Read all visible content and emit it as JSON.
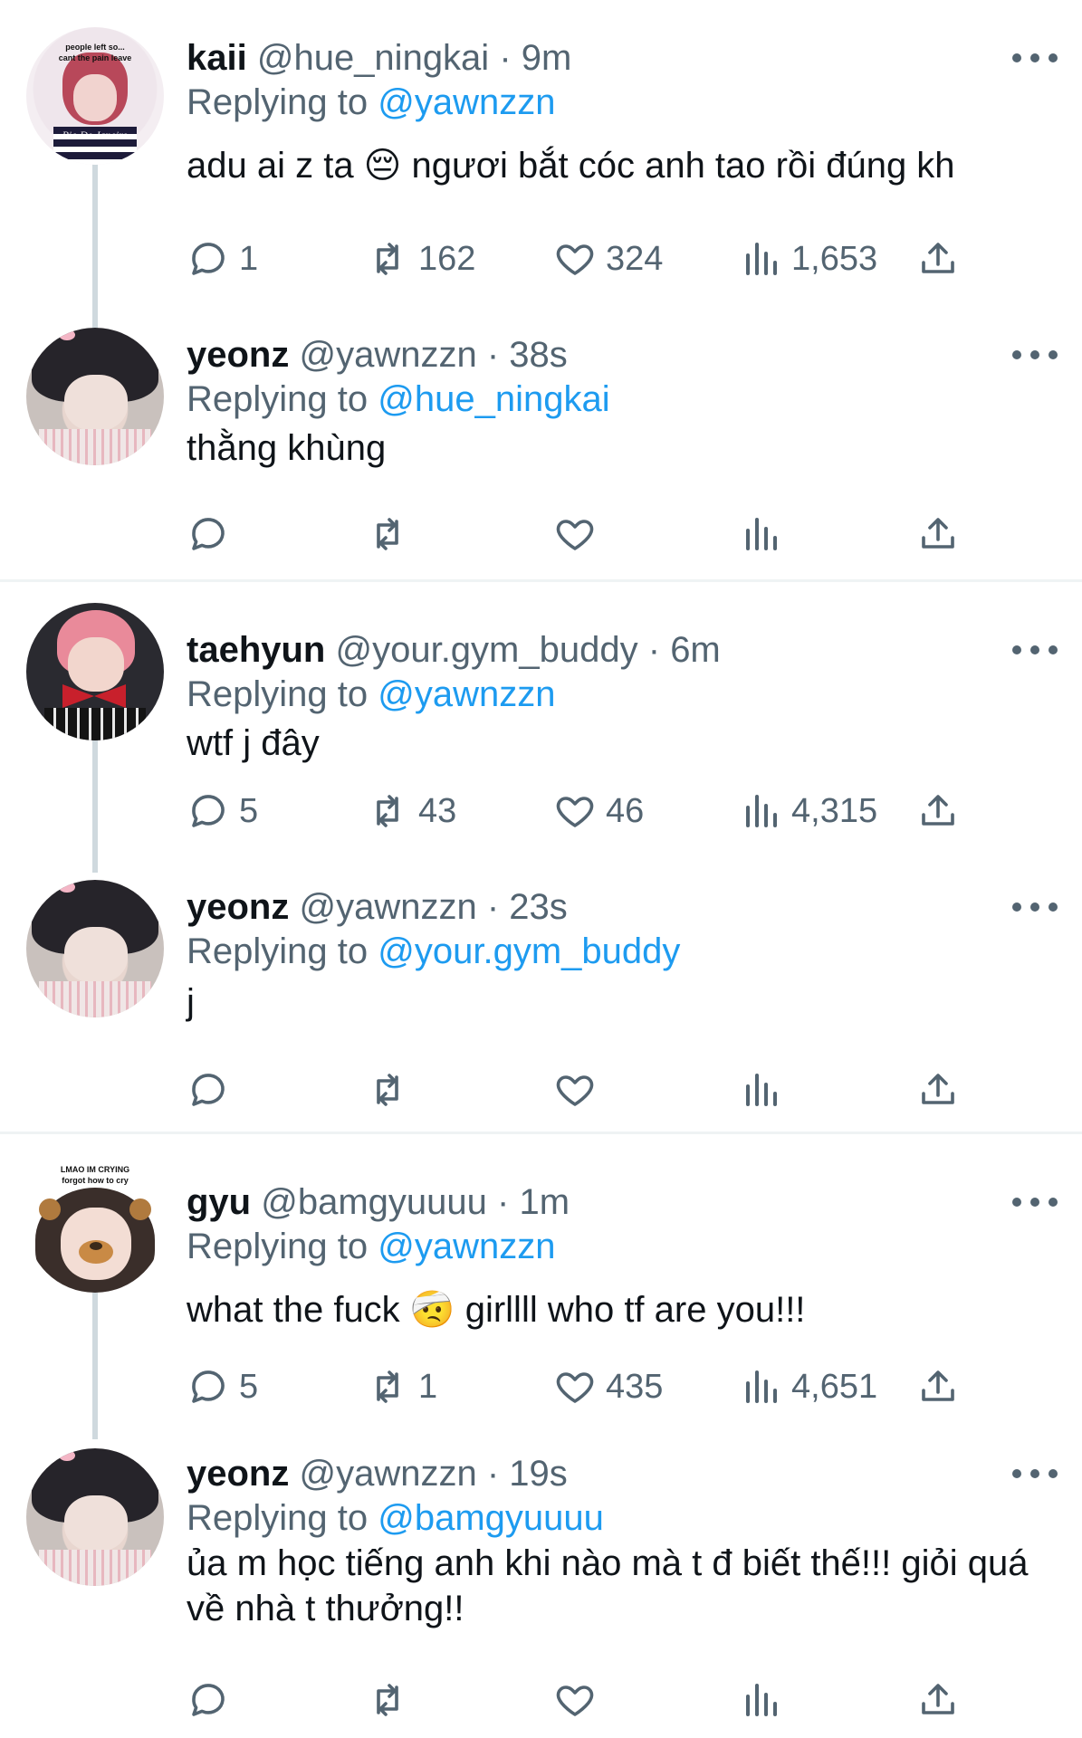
{
  "tweets": [
    {
      "name": "kaii",
      "handle": "@hue_ningkai",
      "time": "9m",
      "replying_prefix": "Replying to",
      "replying_to": "@yawnzzn",
      "text": "adu ai z ta 😔 ngươi bắt cóc anh tao rồi đúng kh",
      "avatar_caption": "people left so...\ncant the pain leave",
      "avatar_watermark": "Rio De Janeiro",
      "replies": "1",
      "retweets": "162",
      "likes": "324",
      "views": "1,653"
    },
    {
      "name": "yeonz",
      "handle": "@yawnzzn",
      "time": "38s",
      "replying_prefix": "Replying to",
      "replying_to": "@hue_ningkai",
      "text": "thằng khùng",
      "replies": "",
      "retweets": "",
      "likes": "",
      "views": ""
    },
    {
      "name": "taehyun",
      "handle": "@your.gym_buddy",
      "time": "6m",
      "replying_prefix": "Replying to",
      "replying_to": "@yawnzzn",
      "text": "wtf j đây",
      "replies": "5",
      "retweets": "43",
      "likes": "46",
      "views": "4,315"
    },
    {
      "name": "yeonz",
      "handle": "@yawnzzn",
      "time": "23s",
      "replying_prefix": "Replying to",
      "replying_to": "@your.gym_buddy",
      "text": "j",
      "replies": "",
      "retweets": "",
      "likes": "",
      "views": ""
    },
    {
      "name": "gyu",
      "handle": "@bamgyuuuu",
      "time": "1m",
      "replying_prefix": "Replying to",
      "replying_to": "@yawnzzn",
      "text": "what the fuck 🤕  girllll who tf are you!!!",
      "avatar_caption": "LMAO IM CRYING\nforgot how to cry",
      "replies": "5",
      "retweets": "1",
      "likes": "435",
      "views": "4,651"
    },
    {
      "name": "yeonz",
      "handle": "@yawnzzn",
      "time": "19s",
      "replying_prefix": "Replying to",
      "replying_to": "@bamgyuuuu",
      "text": "ủa m học tiếng anh khi nào mà t đ biết thế!!! giỏi quá về nhà t thưởng!!",
      "replies": "",
      "retweets": "",
      "likes": "",
      "views": ""
    }
  ],
  "colors": {
    "accent": "#1d9bf0",
    "secondary_text": "#536471",
    "thread_line": "#cfd9de",
    "divider": "#eff3f4"
  },
  "icons": [
    "more-icon",
    "reply-icon",
    "retweet-icon",
    "like-icon",
    "views-icon",
    "share-icon"
  ]
}
